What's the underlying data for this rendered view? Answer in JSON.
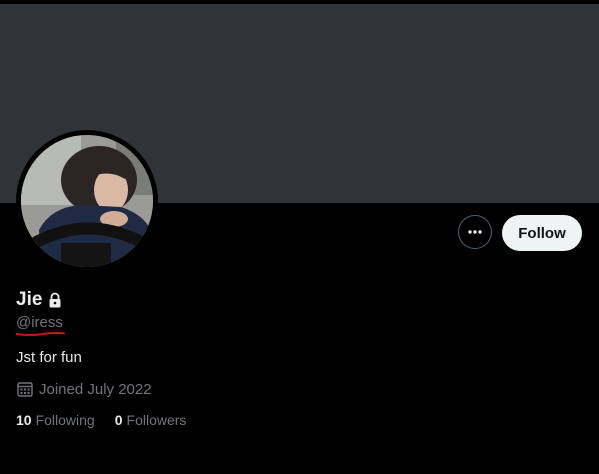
{
  "profile": {
    "display_name": "Jie",
    "handle": "@iress",
    "bio": "Jst for fun",
    "joined": "Joined July 2022",
    "protected_icon": "lock-icon",
    "calendar_icon": "calendar-icon"
  },
  "actions": {
    "more_icon": "more-options-icon",
    "follow_label": "Follow"
  },
  "stats": {
    "following_count": "10",
    "following_label": "Following",
    "followers_count": "0",
    "followers_label": "Followers"
  },
  "colors": {
    "banner": "#313437",
    "background": "#000000",
    "text_primary": "#e7e9ea",
    "text_secondary": "#71767b",
    "follow_button_bg": "#eff3f4",
    "annotation_underline": "#d0111b"
  }
}
